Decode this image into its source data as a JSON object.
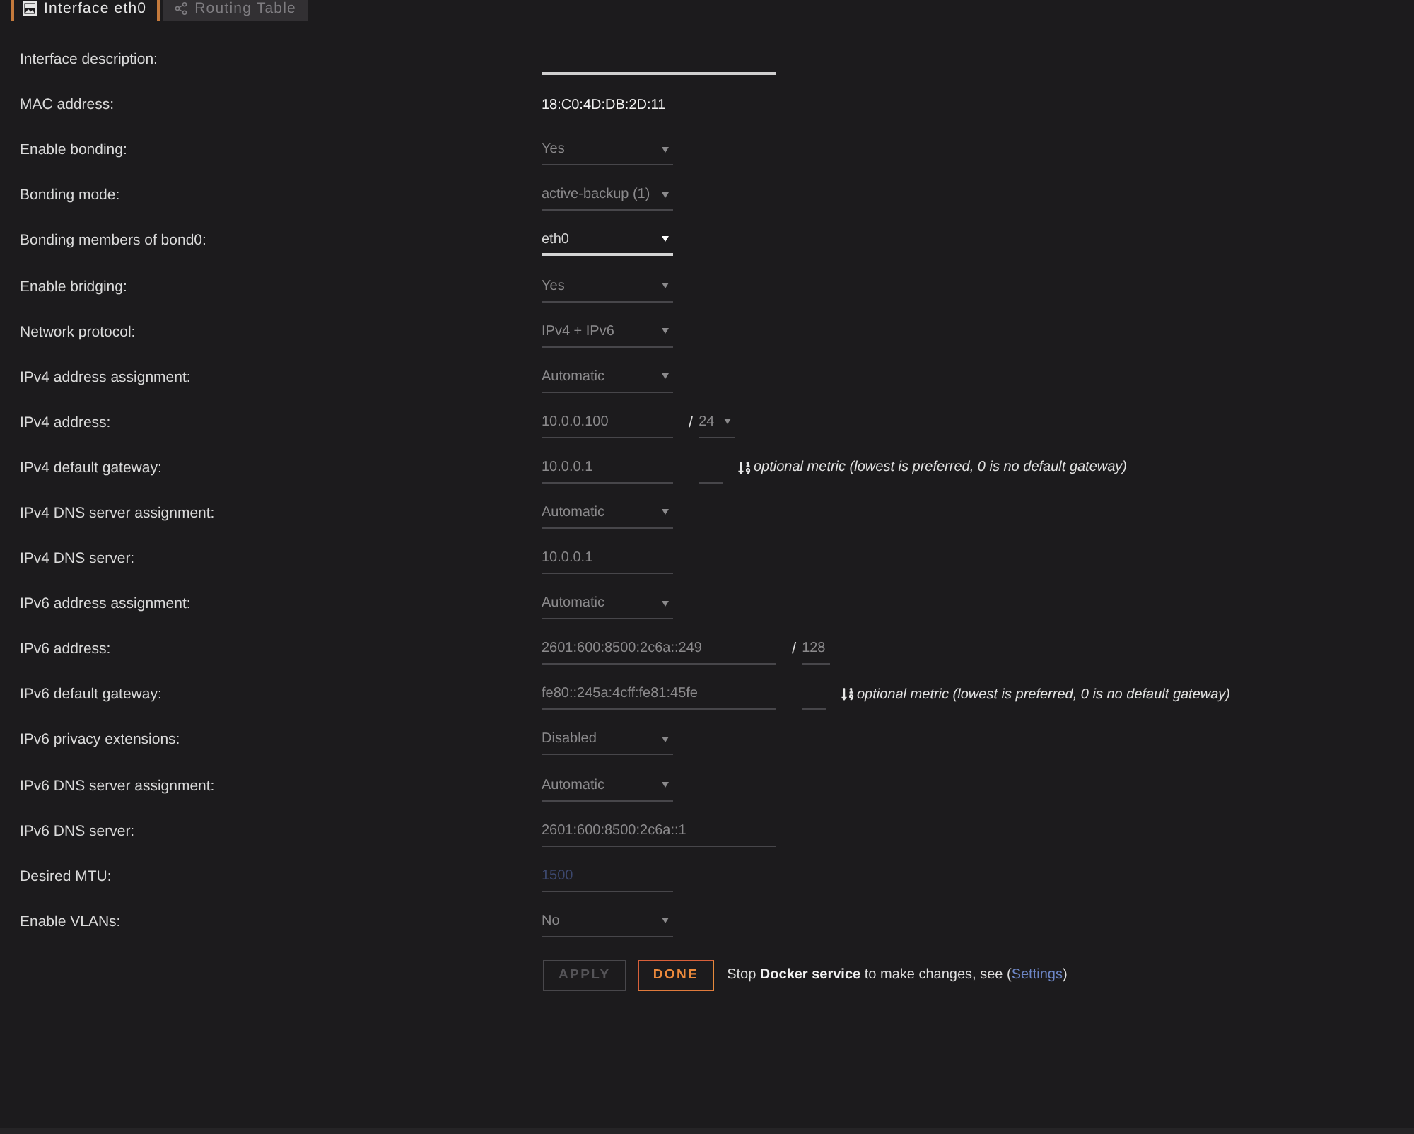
{
  "tabs": [
    {
      "label": "Interface eth0",
      "selected": true
    },
    {
      "label": "Routing Table",
      "selected": false
    }
  ],
  "fields": [
    {
      "label": "Interface description:",
      "kind": "wideinput",
      "disabled": false
    },
    {
      "label": "MAC address:",
      "kind": "static",
      "value": "18:C0:4D:DB:2D:11"
    },
    {
      "label": "Enable bonding:",
      "kind": "select",
      "value": "Yes",
      "disabled": true
    },
    {
      "label": "Bonding mode:",
      "kind": "select",
      "value": "active-backup (1)",
      "disabled": true
    },
    {
      "label": "Bonding members of bond0:",
      "kind": "select",
      "value": "eth0",
      "disabled": false
    },
    {
      "label": "Enable bridging:",
      "kind": "select",
      "value": "Yes",
      "disabled": true
    },
    {
      "label": "Network protocol:",
      "kind": "select",
      "value": "IPv4 + IPv6",
      "disabled": true
    },
    {
      "label": "IPv4 address assignment:",
      "kind": "select",
      "value": "Automatic",
      "disabled": true
    },
    {
      "label": "IPv4 address:",
      "kind": "input",
      "value": "10.0.0.100",
      "disabled": true,
      "prefix": {
        "separator": "/",
        "kind": "select",
        "value": "24",
        "disabled": true
      }
    },
    {
      "label": "IPv4 default gateway:",
      "kind": "input",
      "value": "10.0.0.1",
      "disabled": true,
      "metric": {
        "note": "optional metric (lowest is preferred, 0 is no default gateway)"
      }
    },
    {
      "label": "IPv4 DNS server assignment:",
      "kind": "select",
      "value": "Automatic",
      "disabled": true
    },
    {
      "label": "IPv4 DNS server:",
      "kind": "input",
      "value": "10.0.0.1",
      "disabled": true
    },
    {
      "label": "IPv6 address assignment:",
      "kind": "select",
      "value": "Automatic",
      "disabled": true
    },
    {
      "label": "IPv6 address:",
      "kind": "wideinput",
      "value": "2601:600:8500:2c6a::249",
      "disabled": true,
      "prefix": {
        "separator": "/",
        "kind": "input",
        "value": "128",
        "disabled": true
      }
    },
    {
      "label": "IPv6 default gateway:",
      "kind": "wideinput",
      "value": "fe80::245a:4cff:fe81:45fe",
      "disabled": true,
      "metric": {
        "note": "optional metric (lowest is preferred, 0 is no default gateway)"
      }
    },
    {
      "label": "IPv6 privacy extensions:",
      "kind": "select",
      "value": "Disabled",
      "disabled": true
    },
    {
      "label": "IPv6 DNS server assignment:",
      "kind": "select",
      "value": "Automatic",
      "disabled": true
    },
    {
      "label": "IPv6 DNS server:",
      "kind": "wideinput",
      "value": "2601:600:8500:2c6a::1",
      "disabled": true
    },
    {
      "label": "Desired MTU:",
      "kind": "input",
      "placeholder": "1500",
      "disabled": true
    },
    {
      "label": "Enable VLANs:",
      "kind": "select",
      "value": "No",
      "disabled": true
    }
  ],
  "buttons": [
    {
      "label": "APPLY",
      "kind": "secondary",
      "disabled": true
    },
    {
      "label": "DONE",
      "kind": "primary",
      "disabled": false
    }
  ],
  "notice": {
    "text": "Stop **Docker service** to make changes, see (",
    "link": "Settings",
    "after": ")"
  }
}
